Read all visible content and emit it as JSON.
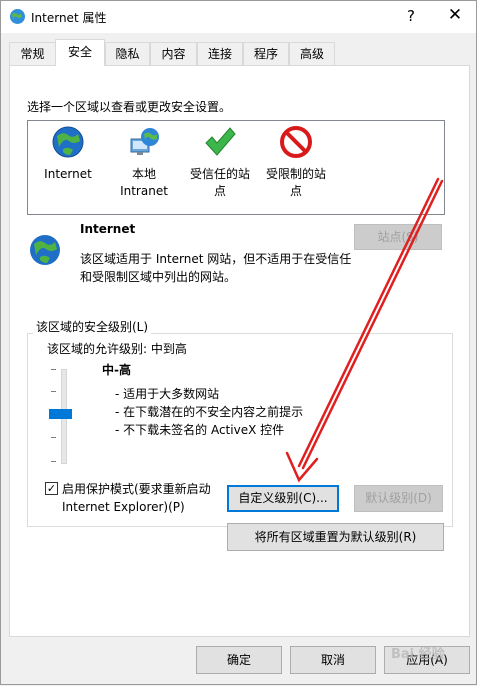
{
  "window": {
    "title": "Internet 属性",
    "help_glyph": "?",
    "close_glyph": "✕"
  },
  "tabs": [
    "常规",
    "安全",
    "隐私",
    "内容",
    "连接",
    "程序",
    "高级"
  ],
  "active_tab": "安全",
  "security": {
    "prompt": "选择一个区域以查看或更改安全设置。",
    "zones": [
      {
        "label": "Internet",
        "icon": "globe-icon"
      },
      {
        "label": "本地\nIntranet",
        "icon": "intranet-icon"
      },
      {
        "label": "受信任的站\n点",
        "icon": "checkmark-icon"
      },
      {
        "label": "受限制的站\n点",
        "icon": "restricted-icon"
      }
    ],
    "selected_zone": {
      "name": "Internet",
      "description": "该区域适用于 Internet 网站，但不适用于在受信任和受限制区域中列出的网站。",
      "sites_button": "站点(S)"
    },
    "level_group": {
      "title": "该区域的安全级别(L)",
      "allowed": "该区域的允许级别: 中到高",
      "level_name": "中-高",
      "level_points": [
        "- 适用于大多数网站",
        "- 在下载潜在的不安全内容之前提示",
        "- 不下载未签名的 ActiveX 控件"
      ],
      "protected_mode_label": "启用保护模式(要求重新启动 Internet Explorer)(P)",
      "protected_mode_checked": true,
      "custom_level_button": "自定义级别(C)...",
      "default_level_button": "默认级别(D)",
      "slider_level_fraction": 0.55
    },
    "reset_all_button": "将所有区域重置为默认级别(R)"
  },
  "footer": {
    "ok": "确定",
    "cancel": "取消",
    "apply": "应用(A)"
  },
  "watermark_text": "Bai 经验",
  "colors": {
    "accent": "#0078d7",
    "annotation_arrow": "#e02020"
  }
}
